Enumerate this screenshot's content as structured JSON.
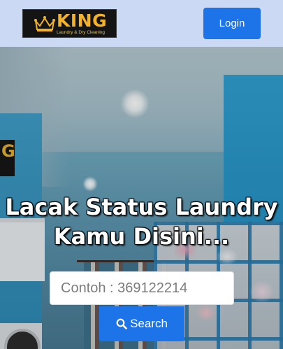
{
  "header": {
    "logo": {
      "brand": "KING",
      "tagline": "Laundry & Dry Cleaning",
      "icon": "crown-icon"
    },
    "login_label": "Login"
  },
  "hero": {
    "sign_fragment": "G",
    "headline_line1": "Lacak Status Laundry",
    "headline_line2": "Kamu Disini...",
    "search": {
      "placeholder": "Contoh : 369122214",
      "button_label": "Search",
      "button_icon": "search-icon"
    }
  },
  "colors": {
    "accent": "#1d73e8",
    "navbar_bg": "#ccd9f5",
    "logo_gold": "#f2b229"
  }
}
